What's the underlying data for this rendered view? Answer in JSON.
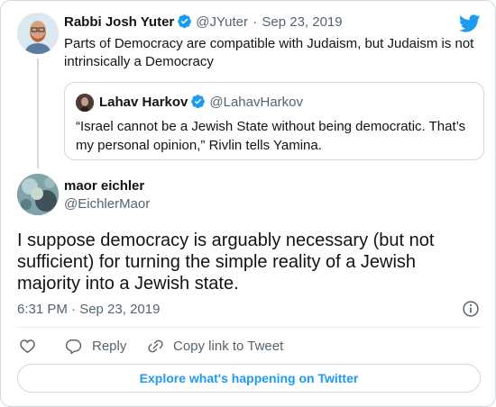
{
  "brand": {
    "icon": "twitter-bird-icon",
    "color": "#1d9bf0"
  },
  "parent_tweet": {
    "author_name": "Rabbi Josh Yuter",
    "verified": true,
    "handle": "@JYuter",
    "separator": "·",
    "date": "Sep 23, 2019",
    "text": "Parts of Democracy are compatible with Judaism, but Judaism is not intrinsically a Democracy"
  },
  "quoted_tweet": {
    "author_name": "Lahav Harkov",
    "verified": true,
    "handle": "@LahavHarkov",
    "text": "“Israel cannot be a Jewish State without being democratic. That’s my personal opinion,” Rivlin tells Yamina."
  },
  "main_tweet": {
    "author_name": "maor eichler",
    "handle": "@EichlerMaor",
    "text": "I suppose democracy is arguably necessary (but not sufficient) for turning the simple reality of a Jewish majority into a Jewish state.",
    "timestamp": "6:31 PM · Sep 23, 2019"
  },
  "actions": {
    "like_icon": "heart-icon",
    "reply_label": "Reply",
    "reply_icon": "reply-bubble-icon",
    "copy_label": "Copy link to Tweet",
    "copy_icon": "link-icon",
    "info_icon": "info-icon"
  },
  "explore_button": {
    "label": "Explore what's happening on Twitter"
  },
  "colors": {
    "text": "#0f1419",
    "secondary": "#536471",
    "border": "#cfd9de",
    "accent": "#1d9bf0"
  }
}
